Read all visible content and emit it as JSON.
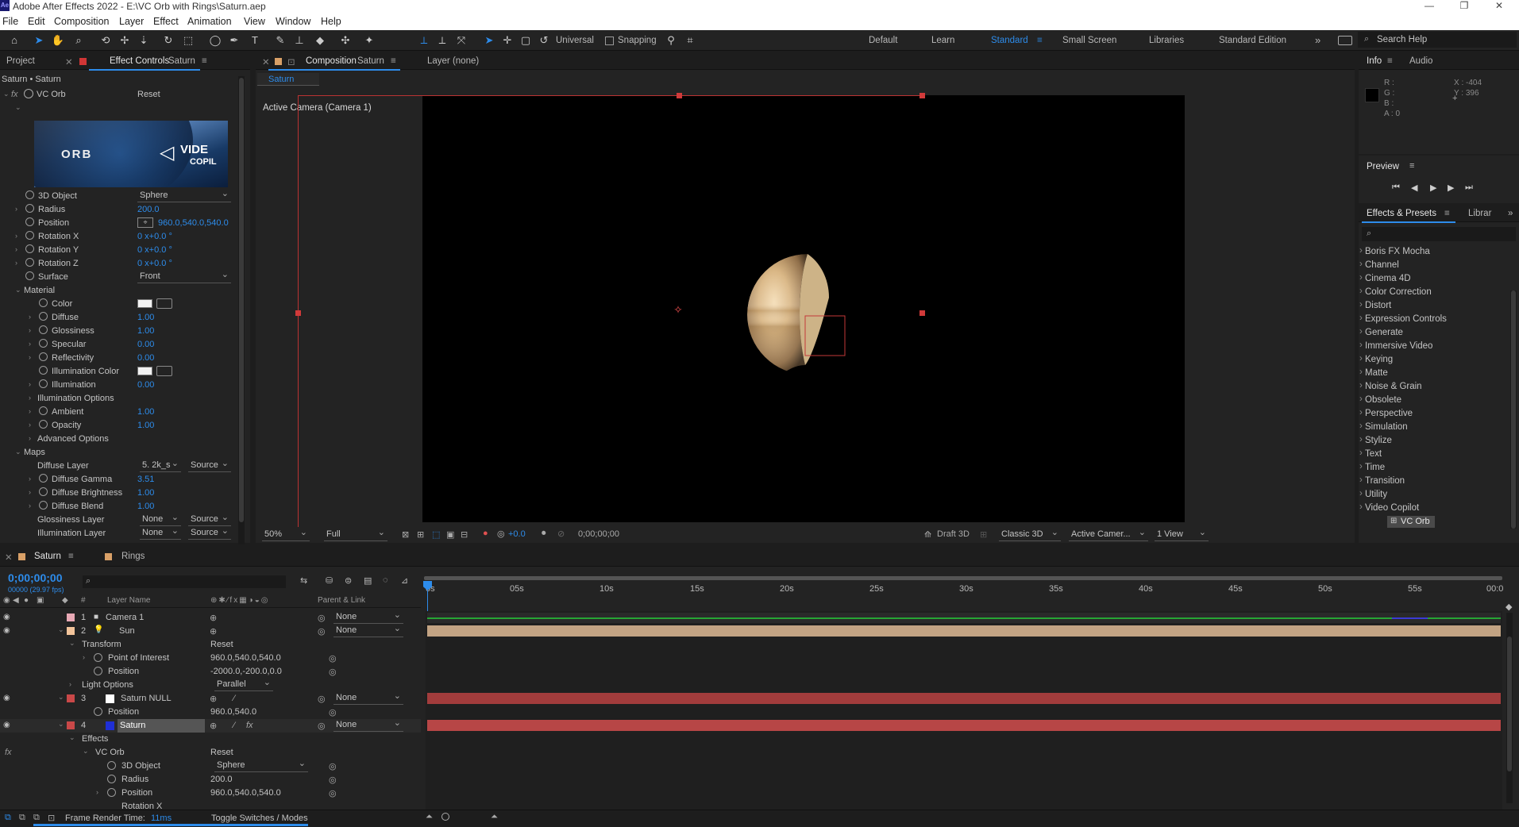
{
  "app": {
    "title": "Adobe After Effects 2022 - E:\\VC Orb with Rings\\Saturn.aep",
    "logo": "Ae",
    "window_controls": [
      "—",
      "❐",
      "✕"
    ]
  },
  "menu": [
    "File",
    "Edit",
    "Composition",
    "Layer",
    "Effect",
    "Animation",
    "View",
    "Window",
    "Help"
  ],
  "toolbar": {
    "universal_label": "Universal",
    "snapping_label": "Snapping",
    "workspaces": [
      "Default",
      "Learn",
      "Standard",
      "Small Screen",
      "Libraries",
      "Standard Edition"
    ],
    "active_workspace": "Standard",
    "search_placeholder": "Search Help"
  },
  "left_panel": {
    "tab_project": "Project",
    "tab_effect_controls": "Effect Controls",
    "tab_effect_layer": "Saturn",
    "breadcrumb": "Saturn • Saturn",
    "effect_name": "VC Orb",
    "effect_reset": "Reset",
    "logo_text_orb": "ORB",
    "logo_text_video": "VIDE",
    "logo_text_copilot": "COPIL",
    "props": [
      {
        "label": "3D Object",
        "value": "Sphere"
      },
      {
        "label": "Radius",
        "value": "200.0"
      },
      {
        "label": "Position",
        "value": "960.0,540.0,540.0"
      },
      {
        "label": "Rotation X",
        "value": "0 x+0.0 °"
      },
      {
        "label": "Rotation Y",
        "value": "0 x+0.0 °"
      },
      {
        "label": "Rotation Z",
        "value": "0 x+0.0 °"
      },
      {
        "label": "Surface",
        "value": "Front"
      }
    ],
    "material_label": "Material",
    "material": [
      {
        "label": "Color",
        "value": ""
      },
      {
        "label": "Diffuse",
        "value": "1.00"
      },
      {
        "label": "Glossiness",
        "value": "1.00"
      },
      {
        "label": "Specular",
        "value": "0.00"
      },
      {
        "label": "Reflectivity",
        "value": "0.00"
      },
      {
        "label": "Illumination Color",
        "value": ""
      },
      {
        "label": "Illumination",
        "value": "0.00"
      },
      {
        "label": "Illumination Options",
        "value": ""
      },
      {
        "label": "Ambient",
        "value": "1.00"
      },
      {
        "label": "Opacity",
        "value": "1.00"
      },
      {
        "label": "Advanced Options",
        "value": ""
      }
    ],
    "maps_label": "Maps",
    "maps": [
      {
        "label": "Diffuse Layer",
        "value": "5. 2k_s",
        "source": "Source"
      },
      {
        "label": "Diffuse Gamma",
        "value": "3.51"
      },
      {
        "label": "Diffuse Brightness",
        "value": "1.00"
      },
      {
        "label": "Diffuse Blend",
        "value": "1.00"
      },
      {
        "label": "Glossiness Layer",
        "value": "None",
        "source": "Source"
      },
      {
        "label": "Illumination Layer",
        "value": "None",
        "source": "Source"
      }
    ]
  },
  "composition": {
    "tab_label": "Composition",
    "tab_name": "Saturn",
    "layer_tab": "Layer (none)",
    "subtab": "Saturn",
    "camera_label": "Active Camera (Camera 1)",
    "zoom": "50%",
    "resolution": "Full",
    "exposure": "+0.0",
    "timecode": "0;00;00;00",
    "draft3d": "Draft 3D",
    "renderer": "Classic 3D",
    "camera_select": "Active Camer...",
    "views": "1 View"
  },
  "info": {
    "tab_info": "Info",
    "tab_audio": "Audio",
    "r": "R :",
    "g": "G :",
    "b": "B :",
    "a": "A : 0",
    "x": "X : -404",
    "y": "Y : 396"
  },
  "preview": {
    "title": "Preview"
  },
  "effects_presets": {
    "tab": "Effects & Presets",
    "tab2": "Librar",
    "search_placeholder": "",
    "items": [
      "Boris FX Mocha",
      "Channel",
      "Cinema 4D",
      "Color Correction",
      "Distort",
      "Expression Controls",
      "Generate",
      "Immersive Video",
      "Keying",
      "Matte",
      "Noise & Grain",
      "Obsolete",
      "Perspective",
      "Simulation",
      "Stylize",
      "Text",
      "Time",
      "Transition",
      "Utility",
      "Video Copilot"
    ],
    "sub_item": "VC Orb"
  },
  "timeline": {
    "tab_saturn": "Saturn",
    "tab_rings": "Rings",
    "timecode": "0;00;00;00",
    "frames": "00000 (29.97 fps)",
    "col_num": "#",
    "col_layer_name": "Layer Name",
    "col_parent": "Parent & Link",
    "ruler": [
      "0s",
      "05s",
      "10s",
      "15s",
      "20s",
      "25s",
      "30s",
      "35s",
      "40s",
      "45s",
      "50s",
      "55s",
      "00:0"
    ],
    "rows": [
      {
        "num": "1",
        "name": "Camera 1",
        "parent": "None"
      },
      {
        "num": "2",
        "name": "Sun",
        "parent": "None"
      },
      {
        "name": "Transform",
        "reset": "Reset"
      },
      {
        "name": "Point of Interest",
        "value": "960.0,540.0,540.0"
      },
      {
        "name": "Position",
        "value": "-2000.0,-200.0,0.0"
      },
      {
        "name": "Light Options",
        "value": "Parallel"
      },
      {
        "num": "3",
        "name": "Saturn NULL",
        "parent": "None"
      },
      {
        "name": "Position",
        "value": "960.0,540.0"
      },
      {
        "num": "4",
        "name": "Saturn",
        "parent": "None"
      },
      {
        "name": "Effects"
      },
      {
        "name": "VC Orb",
        "reset": "Reset"
      },
      {
        "name": "3D Object",
        "value": "Sphere"
      },
      {
        "name": "Radius",
        "value": "200.0"
      },
      {
        "name": "Position",
        "value": "960.0,540.0,540.0"
      },
      {
        "name": "Rotation X"
      }
    ],
    "fx_label": "fx"
  },
  "status": {
    "frame_render_label": "Frame Render Time:",
    "frame_render_value": "11ms",
    "toggle": "Toggle Switches / Modes"
  },
  "colors": {
    "accent": "#2d8ceb",
    "value_red": "#e0414a",
    "label_pink": "#e8a9b5",
    "label_tan": "#f2c49b",
    "layer_red": "#b03a3a",
    "saturn_bar": "#b74646",
    "tan_bar": "#c2a383"
  }
}
